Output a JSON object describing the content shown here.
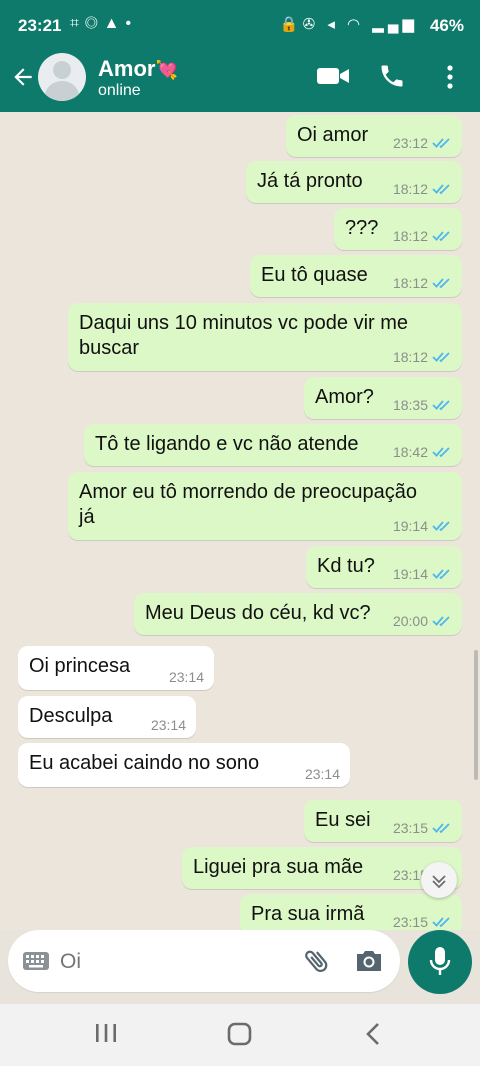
{
  "status_bar": {
    "time": "23:21",
    "battery": "46%",
    "network": "Vo)) LTE1"
  },
  "header": {
    "contact_name": "Amor",
    "name_emoji": "💘",
    "status": "online"
  },
  "colors": {
    "primary": "#0d7a6b",
    "outgoing_bubble": "#dcf8c6",
    "incoming_bubble": "#ffffff",
    "read_ticks": "#4fb6ec",
    "chat_background": "#ebe5dc"
  },
  "messages": [
    {
      "direction": "out",
      "text": "Oi amor",
      "time": "23:12",
      "read": true
    },
    {
      "direction": "out",
      "text": "Já tá pronto",
      "time": "18:12",
      "read": true
    },
    {
      "direction": "out",
      "text": "???",
      "time": "18:12",
      "read": true
    },
    {
      "direction": "out",
      "text": "Eu tô quase",
      "time": "18:12",
      "read": true
    },
    {
      "direction": "out",
      "text": "Daqui uns 10 minutos vc pode vir me\nbuscar",
      "time": "18:12",
      "read": true
    },
    {
      "direction": "out",
      "text": "Amor?",
      "time": "18:35",
      "read": true
    },
    {
      "direction": "out",
      "text": "Tô te ligando e vc não atende",
      "time": "18:42",
      "read": true
    },
    {
      "direction": "out",
      "text": "Amor eu tô morrendo de preocupação\njá",
      "time": "19:14",
      "read": true
    },
    {
      "direction": "out",
      "text": "Kd tu?",
      "time": "19:14",
      "read": true
    },
    {
      "direction": "out",
      "text": "Meu Deus do céu, kd vc?",
      "time": "20:00",
      "read": true
    },
    {
      "direction": "in",
      "text": "Oi princesa",
      "time": "23:14"
    },
    {
      "direction": "in",
      "text": "Desculpa",
      "time": "23:14"
    },
    {
      "direction": "in",
      "text": "Eu acabei caindo no sono",
      "time": "23:14"
    },
    {
      "direction": "out",
      "text": "Eu sei",
      "time": "23:15",
      "read": true
    },
    {
      "direction": "out",
      "text": "Liguei pra sua mãe",
      "time": "23:15",
      "read": true
    },
    {
      "direction": "out",
      "text": "Pra sua irmã",
      "time": "23:15",
      "read": true
    }
  ],
  "composer": {
    "placeholder": "Oi"
  }
}
